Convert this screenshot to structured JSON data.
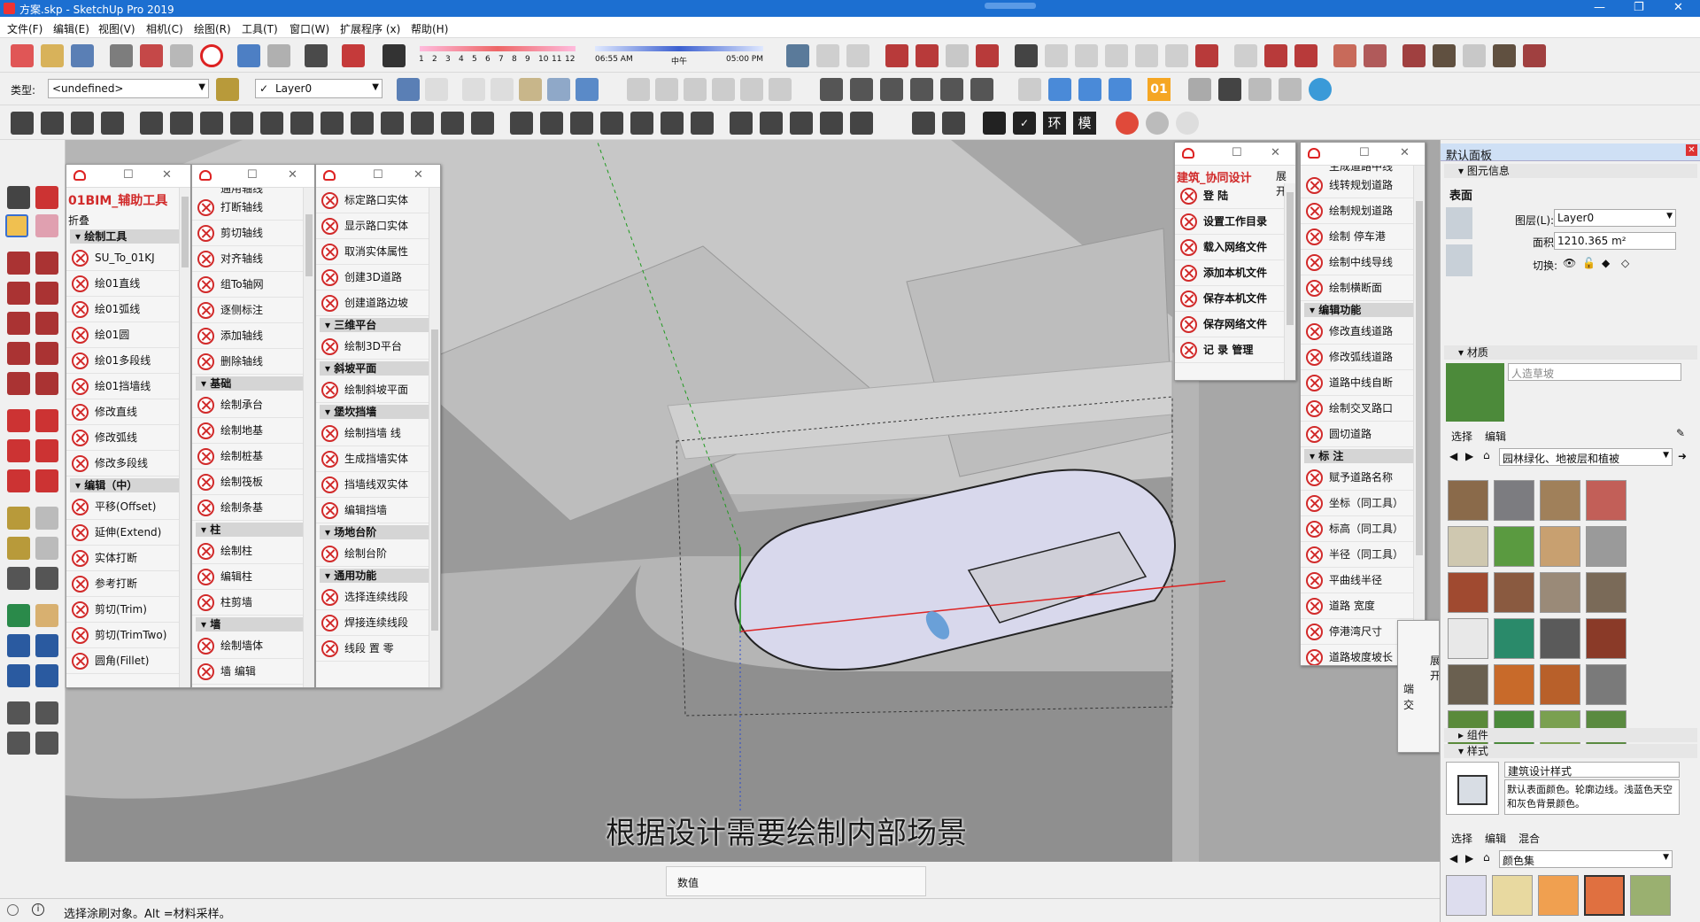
{
  "window": {
    "title": "方案.skp - SketchUp Pro 2019",
    "controls": [
      "—",
      "❐",
      "✕"
    ]
  },
  "menu": [
    "文件(F)",
    "编辑(E)",
    "视图(V)",
    "相机(C)",
    "绘图(R)",
    "工具(T)",
    "窗口(W)",
    "扩展程序 (x)",
    "帮助(H)"
  ],
  "shadow": {
    "nums": [
      "1",
      "2",
      "3",
      "4",
      "5",
      "6",
      "7",
      "8",
      "9",
      "10",
      "11",
      "12"
    ],
    "time_start": "06:55 AM",
    "time_mid": "中午",
    "time_end": "05:00 PM"
  },
  "toolbar2": {
    "type_label": "类型:",
    "type_value": "<undefined>",
    "layer_check": "✓",
    "layer_value": "Layer0",
    "badge": "01"
  },
  "toolbar3": {
    "btn_hj": "环",
    "btn_mo": "模"
  },
  "panel1": {
    "title": "01BIM_辅助工具",
    "fold": "折叠",
    "sections": [
      {
        "name": "绘制工具",
        "items": [
          "SU_To_01KJ",
          "绘01直线",
          "绘01弧线",
          "绘01圆",
          "绘01多段线",
          "绘01挡墙线",
          "修改直线",
          "修改弧线",
          "修改多段线"
        ]
      },
      {
        "name": "编辑（中）",
        "items": [
          "平移(Offset)",
          "延伸(Extend)",
          "实体打断",
          "参考打断",
          "剪切(Trim)",
          "剪切(TrimTwo)",
          "圆角(Fillet)"
        ]
      }
    ]
  },
  "panel2": {
    "top_partial": "通用轴线",
    "items_a": [
      "打断轴线",
      "剪切轴线",
      "对齐轴线",
      "组To轴网",
      "逐侧标注",
      "添加轴线",
      "删除轴线"
    ],
    "sec_b": "基础",
    "items_b": [
      "绘制承台",
      "绘制地基",
      "绘制桩基",
      "绘制筏板",
      "绘制条基"
    ],
    "sec_c": "柱",
    "items_c": [
      "绘制柱",
      "编辑柱",
      "柱剪墙"
    ],
    "sec_d": "墙",
    "items_d": [
      "绘制墙体",
      "墙  编辑"
    ]
  },
  "panel3": {
    "items_a": [
      "标定路口实体",
      "显示路口实体",
      "取消实体属性",
      "创建3D道路",
      "创建道路边坡"
    ],
    "sec_b": "三维平台",
    "items_b": [
      "绘制3D平台"
    ],
    "sec_c": "斜坡平面",
    "items_c": [
      "绘制斜坡平面"
    ],
    "sec_d": "堡坎挡墙",
    "items_d": [
      "绘制挡墙  线",
      "生成挡墙实体",
      "挡墙线双实体",
      "编辑挡墙"
    ],
    "sec_e": "场地台阶",
    "items_e": [
      "绘制台阶"
    ],
    "sec_f": "通用功能",
    "items_f": [
      "选择连续线段",
      "焊接连续线段",
      "线段  置  零"
    ]
  },
  "panel4": {
    "title": "建筑_协同设计",
    "expand": "展开",
    "items": [
      "登        陆",
      "设置工作目录",
      "载入网络文件",
      "添加本机文件",
      "保存本机文件",
      "保存网络文件",
      "记  录  管理"
    ]
  },
  "panel5": {
    "top_partial": "生成道路中线",
    "items_a": [
      "线转规划道路",
      "绘制规划道路",
      "绘制  停车港",
      "绘制中线导线",
      "绘制横断面"
    ],
    "sec_b": "编辑功能",
    "items_b": [
      "修改直线道路",
      "修改弧线道路",
      "道路中线自断",
      "绘制交叉路口",
      "圆切道路"
    ],
    "sec_c": "标    注",
    "items_c": [
      "赋予道路名称",
      "坐标（同工具）",
      "标高（同工具）",
      "半径（同工具）",
      "平曲线半径",
      "道路    宽度",
      "停港湾尺寸",
      "道路坡度坡长"
    ]
  },
  "side_partial": [
    "展开",
    "端",
    "交"
  ],
  "subtitle": "根据设计需要绘制内部场景",
  "measure_label": "数值",
  "status": "选择涂刷对象。Alt =材料采样。",
  "tray": {
    "title": "默认面板",
    "entity_info": "图元信息",
    "surface": "表面",
    "layer_label": "图层(L):",
    "layer_value": "Layer0",
    "area_label": "面积:",
    "area_value": "1210.365 m²",
    "toggle_label": "切换:",
    "materials": "材质",
    "material_name": "人造草坡",
    "tab_select": "选择",
    "tab_edit": "编辑",
    "collection": "园林绿化、地被层和植被",
    "components": "组件",
    "styles": "样式",
    "style_name": "建筑设计样式",
    "style_desc": "默认表面颜色。轮廓边线。浅蓝色天空和灰色背景颜色。",
    "style_tab_select": "选择",
    "style_tab_edit": "编辑",
    "style_tab_mix": "混合",
    "style_collection": "颜色集"
  },
  "tray_colors": [
    "#8a6a4a",
    "#7c7c80",
    "#a0805a",
    "#c25f58",
    "#cfc8b0",
    "#5a9a40",
    "#c8a070",
    "#9a9a9a",
    "#a04a30",
    "#8a5a40",
    "#9a8a78",
    "#7a6a58",
    "#e8e8e8",
    "#2a8a6a",
    "#5a5a5a",
    "#8a3a28",
    "#6a6050",
    "#c86a2a",
    "#b8602a",
    "#7a7a7a",
    "#5a8a3a",
    "#4a8a3a",
    "#7aa050",
    "#5a8a40"
  ]
}
